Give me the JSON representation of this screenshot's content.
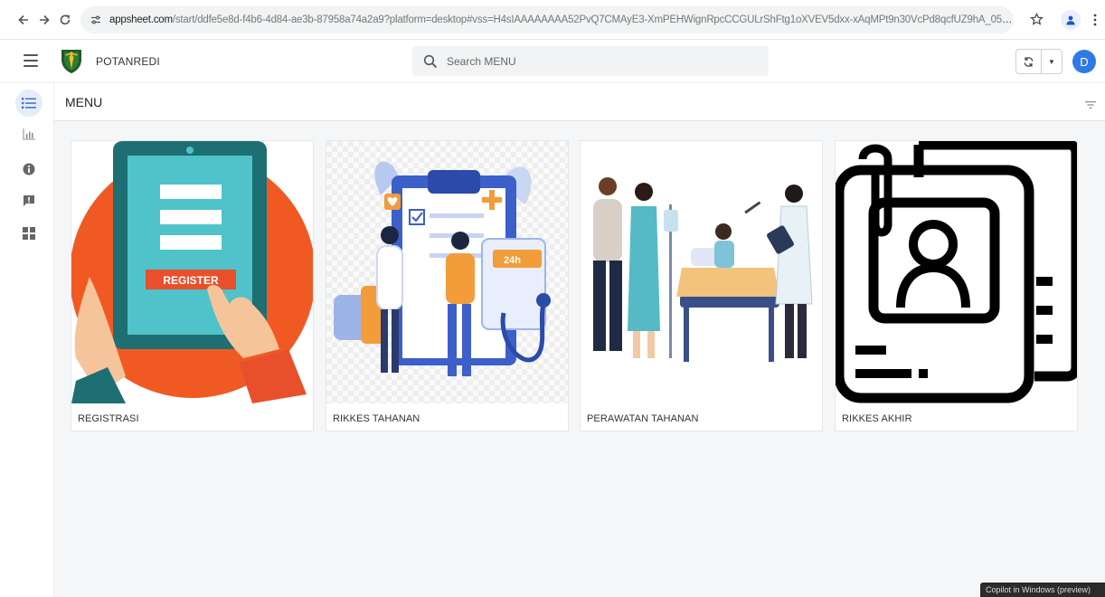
{
  "browser": {
    "url_host": "appsheet.com",
    "url_rest": "/start/ddfe5e8d-f4b6-4d84-ae3b-87958a74a2a9?platform=desktop#vss=H4sIAAAAAAAA52PvQ7CMAyE3-XmPEHWignRpcCCGULrShFtg1oXVEV5dxx-xAqMPt9n30VcPd8qcfUZ9hA_05oX..."
  },
  "header": {
    "app_name": "POTANREDI",
    "search_placeholder": "Search MENU",
    "avatar_letter": "D"
  },
  "view": {
    "title": "MENU"
  },
  "cards": [
    {
      "label": "REGISTRASI",
      "image_text": "REGISTER"
    },
    {
      "label": "RIKKES TAHANAN",
      "image_text": "24h"
    },
    {
      "label": "PERAWATAN TAHANAN"
    },
    {
      "label": "RIKKES AKHIR"
    }
  ],
  "toast": {
    "text": "Copilot in Windows (preview)"
  },
  "colors": {
    "accent": "#2f7be5",
    "register_tablet": "#1e6f73",
    "register_screen": "#4fc3c9",
    "register_button": "#e8502c",
    "register_circle": "#f05a22"
  }
}
